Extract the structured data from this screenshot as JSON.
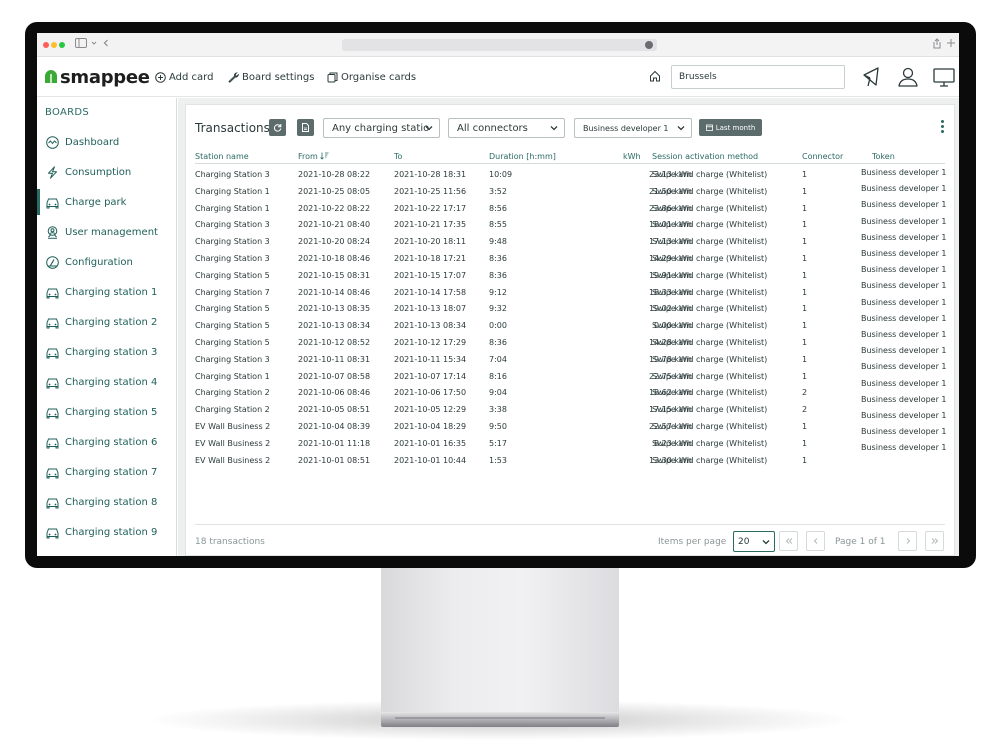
{
  "header": {
    "logo_text": "smappee",
    "add_card": "Add card",
    "board_settings": "Board settings",
    "organise_cards": "Organise cards",
    "location": "Brussels"
  },
  "sidebar": {
    "heading": "BOARDS",
    "items": [
      {
        "label": "Dashboard",
        "icon": "dashboard-gauge-icon"
      },
      {
        "label": "Consumption",
        "icon": "lightning-icon"
      },
      {
        "label": "Charge park",
        "icon": "car-icon"
      },
      {
        "label": "User management",
        "icon": "user-badge-icon"
      },
      {
        "label": "Configuration",
        "icon": "gauge-icon"
      },
      {
        "label": "Charging station 1",
        "icon": "car-icon"
      },
      {
        "label": "Charging station 2",
        "icon": "car-icon"
      },
      {
        "label": "Charging station 3",
        "icon": "car-icon"
      },
      {
        "label": "Charging station 4",
        "icon": "car-icon"
      },
      {
        "label": "Charging station 5",
        "icon": "car-icon"
      },
      {
        "label": "Charging station 6",
        "icon": "car-icon"
      },
      {
        "label": "Charging station 7",
        "icon": "car-icon"
      },
      {
        "label": "Charging station 8",
        "icon": "car-icon"
      },
      {
        "label": "Charging station 9",
        "icon": "car-icon"
      }
    ],
    "active_item": "Charge park"
  },
  "card": {
    "title": "Transactions",
    "filters": {
      "station": "Any charging statio",
      "connector": "All connectors",
      "token": "Business developer 1",
      "period": "Last month"
    },
    "columns": {
      "station": "Station name",
      "from": "From",
      "to": "To",
      "duration": "Duration [h:mm]",
      "kwh": "kWh",
      "method": "Session activation method",
      "connector": "Connector",
      "token": "Token"
    },
    "rows": [
      {
        "station": "Charging Station 3",
        "from": "2021-10-28 08:22",
        "to": "2021-10-28 18:31",
        "duration": "10:09",
        "kwh": "23.13 kWh",
        "method": "Swipe and charge (Whitelist)",
        "connector": "1"
      },
      {
        "station": "Charging Station 1",
        "from": "2021-10-25 08:05",
        "to": "2021-10-25 11:56",
        "duration": "3:52",
        "kwh": "21.50 kWh",
        "method": "Swipe and charge (Whitelist)",
        "connector": "1"
      },
      {
        "station": "Charging Station 1",
        "from": "2021-10-22 08:22",
        "to": "2021-10-22 17:17",
        "duration": "8:56",
        "kwh": "23.86 kWh",
        "method": "Swipe and charge (Whitelist)",
        "connector": "1"
      },
      {
        "station": "Charging Station 3",
        "from": "2021-10-21 08:40",
        "to": "2021-10-21 17:35",
        "duration": "8:55",
        "kwh": "18.01 kWh",
        "method": "Swipe and charge (Whitelist)",
        "connector": "1"
      },
      {
        "station": "Charging Station 3",
        "from": "2021-10-20 08:24",
        "to": "2021-10-20 18:11",
        "duration": "9:48",
        "kwh": "17.13 kWh",
        "method": "Swipe and charge (Whitelist)",
        "connector": "1"
      },
      {
        "station": "Charging Station 3",
        "from": "2021-10-18 08:46",
        "to": "2021-10-18 17:21",
        "duration": "8:36",
        "kwh": "14.29 kWh",
        "method": "Swipe and charge (Whitelist)",
        "connector": "1"
      },
      {
        "station": "Charging Station 5",
        "from": "2021-10-15 08:31",
        "to": "2021-10-15 17:07",
        "duration": "8:36",
        "kwh": "19.91 kWh",
        "method": "Swipe and charge (Whitelist)",
        "connector": "1"
      },
      {
        "station": "Charging Station 7",
        "from": "2021-10-14 08:46",
        "to": "2021-10-14 17:58",
        "duration": "9:12",
        "kwh": "18.33 kWh",
        "method": "Swipe and charge (Whitelist)",
        "connector": "1"
      },
      {
        "station": "Charging Station 5",
        "from": "2021-10-13 08:35",
        "to": "2021-10-13 18:07",
        "duration": "9:32",
        "kwh": "19.02 kWh",
        "method": "Swipe and charge (Whitelist)",
        "connector": "1"
      },
      {
        "station": "Charging Station 5",
        "from": "2021-10-13 08:34",
        "to": "2021-10-13 08:34",
        "duration": "0:00",
        "kwh": "0.00 kWh",
        "method": "Swipe and charge (Whitelist)",
        "connector": "1"
      },
      {
        "station": "Charging Station 5",
        "from": "2021-10-12 08:52",
        "to": "2021-10-12 17:29",
        "duration": "8:36",
        "kwh": "14.28 kWh",
        "method": "Swipe and charge (Whitelist)",
        "connector": "1"
      },
      {
        "station": "Charging Station 3",
        "from": "2021-10-11 08:31",
        "to": "2021-10-11 15:34",
        "duration": "7:04",
        "kwh": "19.78 kWh",
        "method": "Swipe and charge (Whitelist)",
        "connector": "1"
      },
      {
        "station": "Charging Station 1",
        "from": "2021-10-07 08:58",
        "to": "2021-10-07 17:14",
        "duration": "8:16",
        "kwh": "22.75 kWh",
        "method": "Swipe and charge (Whitelist)",
        "connector": "1"
      },
      {
        "station": "Charging Station 2",
        "from": "2021-10-06 08:46",
        "to": "2021-10-06 17:50",
        "duration": "9:04",
        "kwh": "18.62 kWh",
        "method": "Swipe and charge (Whitelist)",
        "connector": "2"
      },
      {
        "station": "Charging Station 2",
        "from": "2021-10-05 08:51",
        "to": "2021-10-05 12:29",
        "duration": "3:38",
        "kwh": "17.15 kWh",
        "method": "Swipe and charge (Whitelist)",
        "connector": "2"
      },
      {
        "station": "EV Wall Business 2",
        "from": "2021-10-04 08:39",
        "to": "2021-10-04 18:29",
        "duration": "9:50",
        "kwh": "22.57 kWh",
        "method": "Swipe and charge (Whitelist)",
        "connector": "1"
      },
      {
        "station": "EV Wall Business 2",
        "from": "2021-10-01 11:18",
        "to": "2021-10-01 16:35",
        "duration": "5:17",
        "kwh": "8.23 kWh",
        "method": "Swipe and charge (Whitelist)",
        "connector": "1"
      },
      {
        "station": "EV Wall Business 2",
        "from": "2021-10-01 08:51",
        "to": "2021-10-01 10:44",
        "duration": "1:53",
        "kwh": "13.30 kWh",
        "method": "Swipe and charge (Whitelist)",
        "connector": "1"
      }
    ],
    "tokens": [
      "Business developer 1",
      "Business developer 1",
      "Business developer 1",
      "Business developer 1",
      "Business developer 1",
      "Business developer 1",
      "Business developer 1",
      "Business developer 1",
      "Business developer 1",
      "Business developer 1",
      "Business developer 1",
      "Business developer 1",
      "Business developer 1",
      "Business developer 1",
      "Business developer 1",
      "Business developer 1",
      "Business developer 1",
      "Business developer 1"
    ],
    "footer": {
      "count": "18 transactions",
      "items_per_page_label": "Items per page",
      "items_per_page": "20",
      "page_info": "Page 1 of 1"
    }
  },
  "colors": {
    "brand_green": "#3aa935",
    "accent_teal": "#2a6b64",
    "button_grey": "#5c6b6b"
  }
}
